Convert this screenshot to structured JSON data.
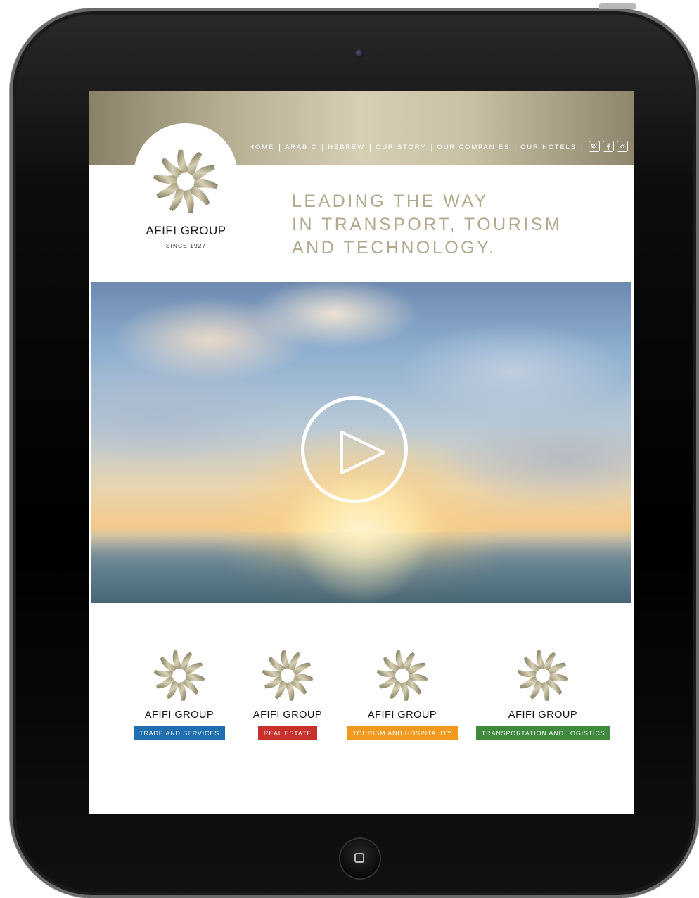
{
  "nav": {
    "items": [
      "HOME",
      "ARABIC",
      "HEBREW",
      "OUR STORY",
      "OUR COMPANIES",
      "OUR HOTELS"
    ],
    "separator": "|"
  },
  "social": {
    "icons": [
      "twitter-icon",
      "facebook-icon",
      "instagram-icon"
    ]
  },
  "brand": {
    "name": "AFIFI GROUP",
    "since": "SINCE 1927",
    "color": "#b3a98c"
  },
  "hero": {
    "tagline_line1": "LEADING THE WAY",
    "tagline_line2": "IN TRANSPORT, TOURISM",
    "tagline_line3": "AND TECHNOLOGY."
  },
  "video": {
    "play_icon": "play-icon"
  },
  "companies": [
    {
      "name": "AFIFI GROUP",
      "division": "TRADE AND SERVICES",
      "color": "#1f6fb0"
    },
    {
      "name": "AFIFI GROUP",
      "division": "REAL ESTATE",
      "color": "#c8302c"
    },
    {
      "name": "AFIFI GROUP",
      "division": "TOURISM AND HOSPITALITY",
      "color": "#f29a1d"
    },
    {
      "name": "AFIFI GROUP",
      "division": "TRANSPORTATION AND LOGISTICS",
      "color": "#3f8a3c"
    }
  ]
}
